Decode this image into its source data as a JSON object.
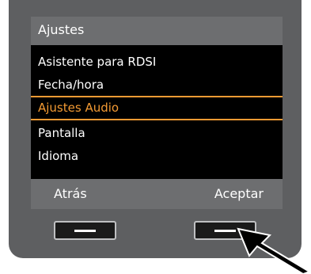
{
  "header": {
    "title": "Ajustes"
  },
  "menu": {
    "items": [
      {
        "label": "Asistente para RDSI",
        "selected": false
      },
      {
        "label": "Fecha/hora",
        "selected": false
      },
      {
        "label": "Ajustes Audio",
        "selected": true
      },
      {
        "label": "Pantalla",
        "selected": false
      },
      {
        "label": "Idioma",
        "selected": false
      }
    ]
  },
  "softkeys": {
    "left_label": "Atrás",
    "right_label": "Aceptar"
  },
  "colors": {
    "bezel": "#5e5f61",
    "header": "#6d6e70",
    "menu_background": "#000000",
    "selection_accent": "#f39a33",
    "text": "#ffffff"
  },
  "icons": {
    "pointer": "pointer-arrow-icon"
  }
}
